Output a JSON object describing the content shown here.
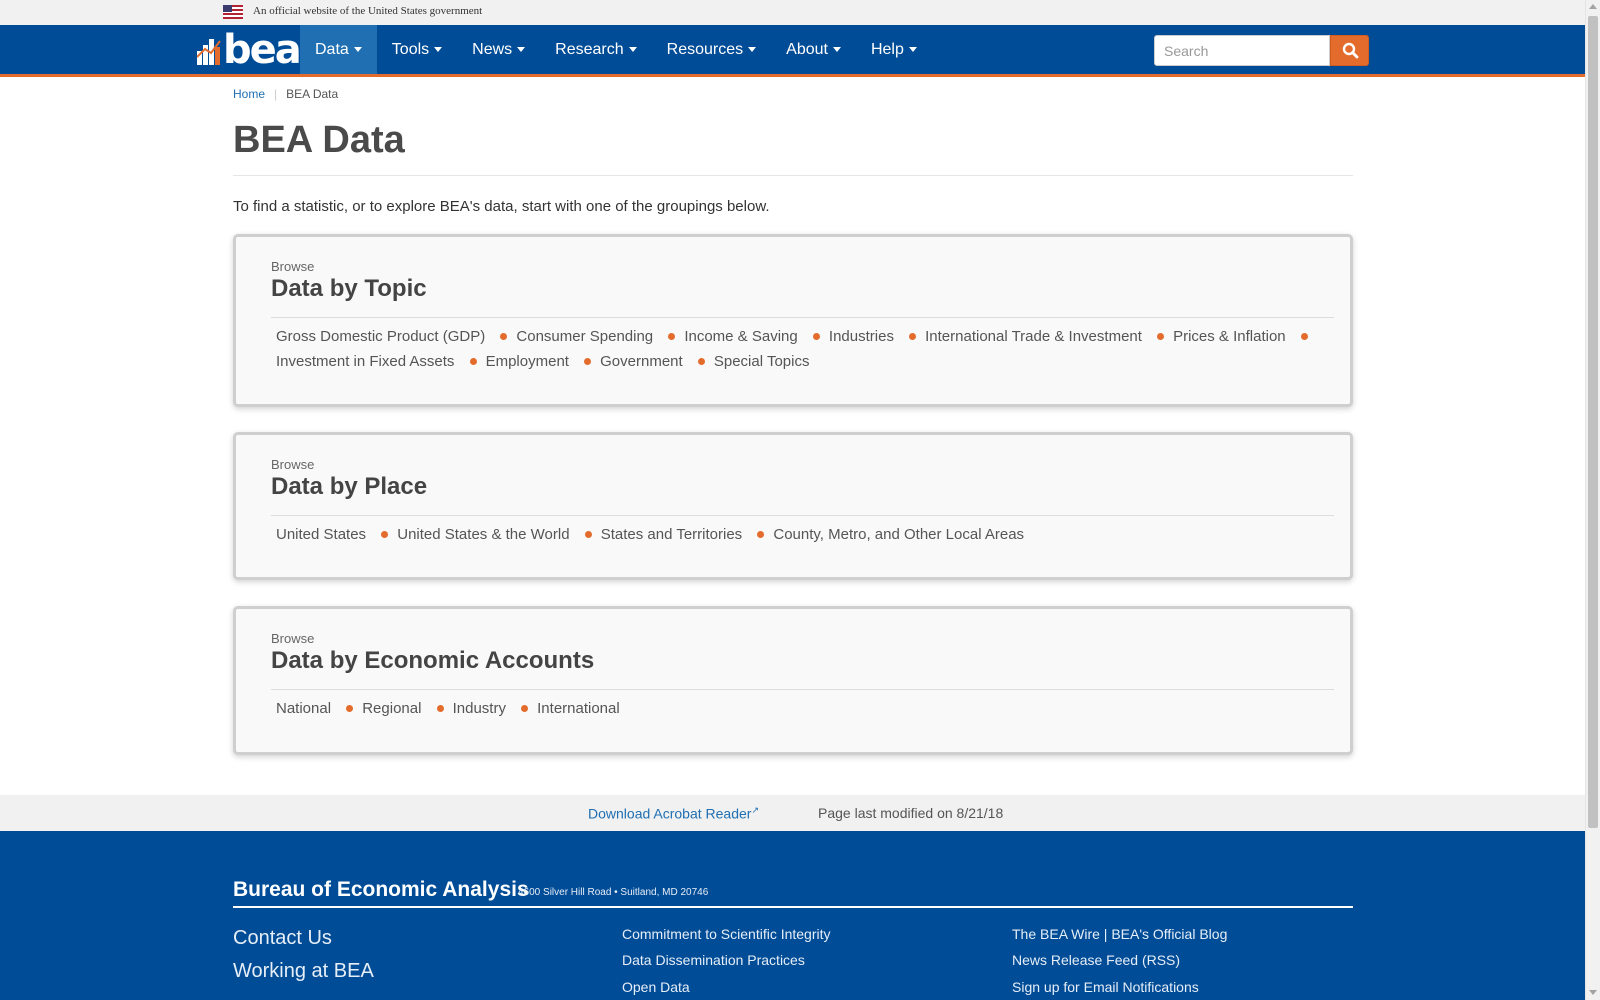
{
  "gov_banner": {
    "text": "An official website of the United States government"
  },
  "header": {
    "logo_text": "bea",
    "nav": [
      {
        "label": "Data",
        "active": true
      },
      {
        "label": "Tools",
        "active": false
      },
      {
        "label": "News",
        "active": false
      },
      {
        "label": "Research",
        "active": false
      },
      {
        "label": "Resources",
        "active": false
      },
      {
        "label": "About",
        "active": false
      },
      {
        "label": "Help",
        "active": false
      }
    ],
    "search_placeholder": "Search",
    "search_icon": "search-icon"
  },
  "breadcrumb": {
    "home": "Home",
    "current": "BEA Data"
  },
  "page": {
    "title": "BEA Data",
    "intro": "To find a statistic, or to explore BEA's data, start with one of the groupings below."
  },
  "cards": [
    {
      "browse": "Browse",
      "title": "Data by Topic",
      "links": [
        "Gross Domestic Product (GDP)",
        "Consumer Spending",
        "Income & Saving",
        "Industries",
        "International Trade & Investment",
        "Prices & Inflation",
        "Investment in Fixed Assets",
        "Employment",
        "Government",
        "Special Topics"
      ]
    },
    {
      "browse": "Browse",
      "title": "Data by Place",
      "links": [
        "United States",
        "United States & the World",
        "States and Territories",
        "County, Metro, and Other Local Areas"
      ]
    },
    {
      "browse": "Browse",
      "title": "Data by Economic Accounts",
      "links": [
        "National",
        "Regional",
        "Industry",
        "International"
      ]
    }
  ],
  "sub_footer": {
    "acrobat": "Download Acrobat Reader",
    "modified": "Page last modified on 8/21/18"
  },
  "footer": {
    "org": "Bureau of Economic Analysis",
    "address": "4600 Silver Hill Road • Suitland, MD 20746",
    "col1": [
      "Contact Us",
      "Working at BEA"
    ],
    "col2": [
      "Commitment to Scientific Integrity",
      "Data Dissemination Practices",
      "Open Data"
    ],
    "col3": [
      "The BEA Wire | BEA's Official Blog",
      "News Release Feed (RSS)",
      "Sign up for Email Notifications"
    ]
  },
  "colors": {
    "navbar": "#004c97",
    "accent": "#e36c2c",
    "link": "#1f6fb2"
  }
}
